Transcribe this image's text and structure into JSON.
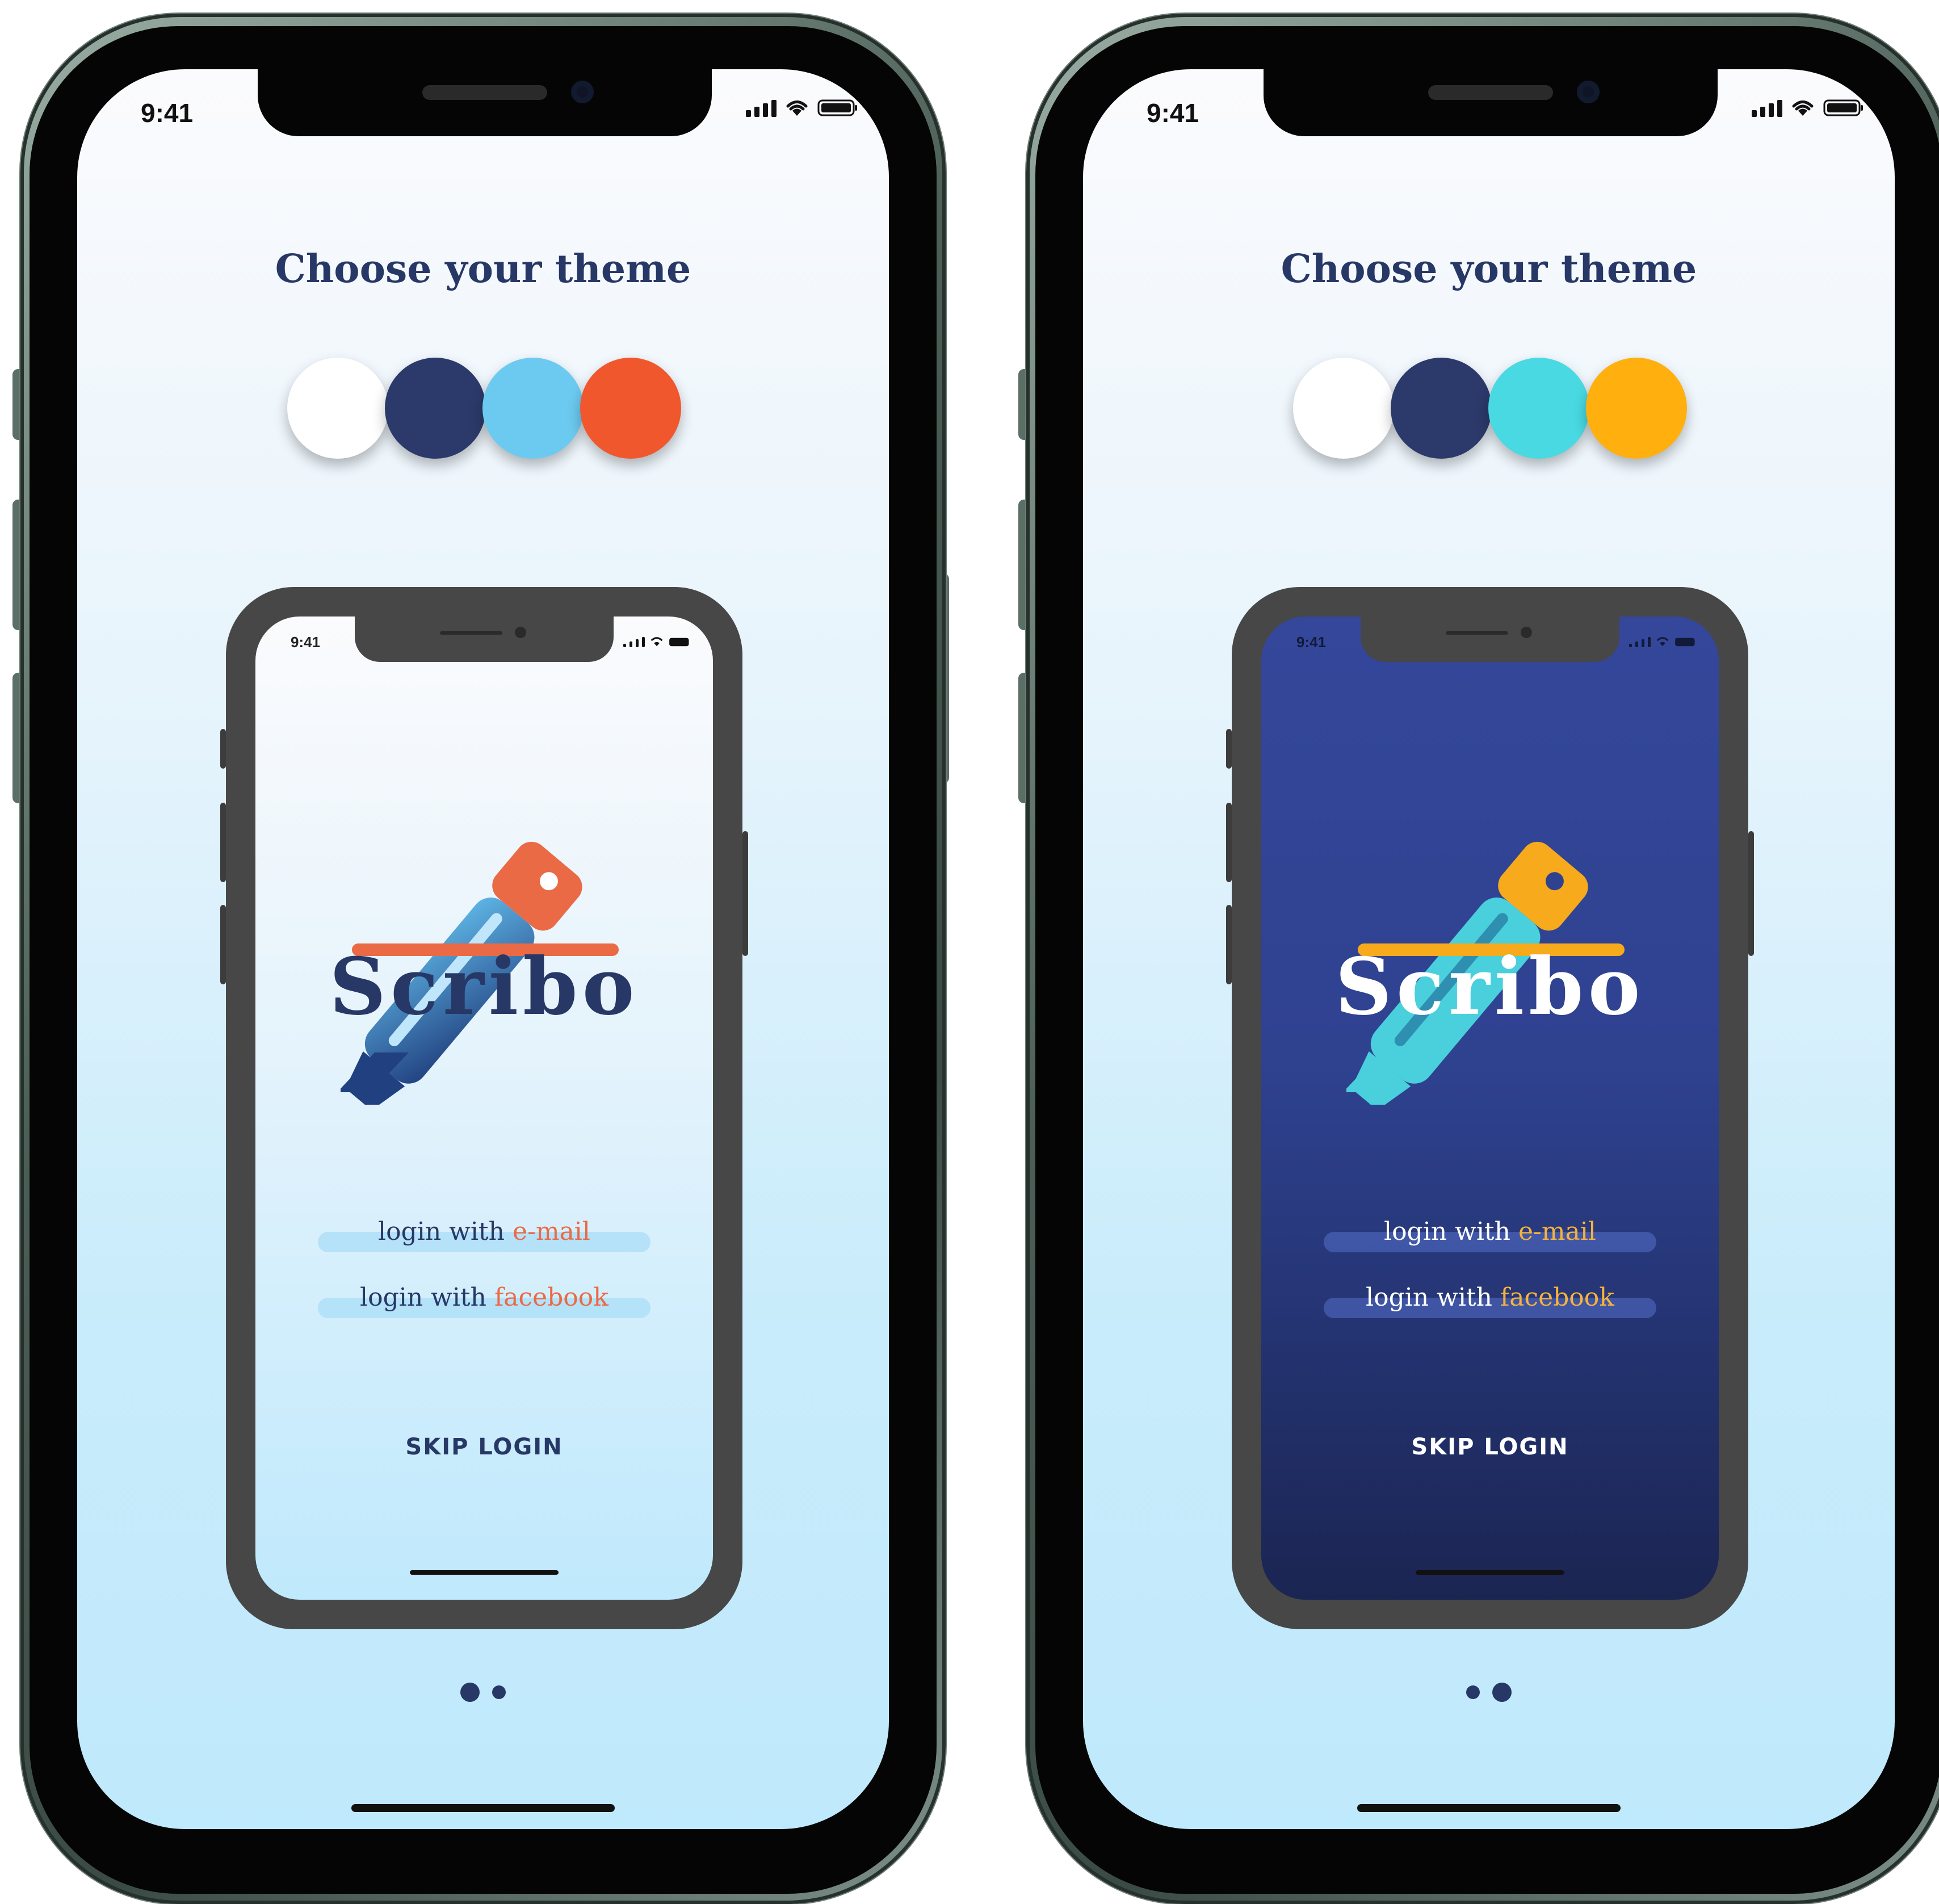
{
  "phones": [
    {
      "status_time": "9:41",
      "title": "Choose your theme",
      "swatches": [
        "#ffffff",
        "#2b3a6b",
        "#6ccaf0",
        "#f0572d"
      ],
      "preview": {
        "theme": "light",
        "status_time": "9:41",
        "logo_text": "Scribo",
        "login_email_prefix": "login with",
        "login_email_accent": "e-mail",
        "login_facebook_prefix": "login with",
        "login_facebook_accent": "facebook",
        "skip_login": "SKIP LOGIN"
      },
      "pager_active_index": 0
    },
    {
      "status_time": "9:41",
      "title": "Choose your theme",
      "swatches": [
        "#ffffff",
        "#2b3a6b",
        "#49d9e2",
        "#ffb00f"
      ],
      "preview": {
        "theme": "dark",
        "status_time": "9:41",
        "logo_text": "Scribo",
        "login_email_prefix": "login with",
        "login_email_accent": "e-mail",
        "login_facebook_prefix": "login with",
        "login_facebook_accent": "facebook",
        "skip_login": "SKIP LOGIN"
      },
      "pager_active_index": 1
    }
  ],
  "colors": {
    "navy": "#273866",
    "light_accent": "#ea6a45",
    "dark_accent": "#f6b33c",
    "light_pen_body": "#2c5da6",
    "light_pen_cap": "#ea6a45",
    "dark_pen_body": "#49d0dc",
    "dark_pen_cap": "#f6aa1c"
  },
  "icons": [
    "signal-icon",
    "wifi-icon",
    "battery-icon",
    "pen-logo-icon"
  ]
}
